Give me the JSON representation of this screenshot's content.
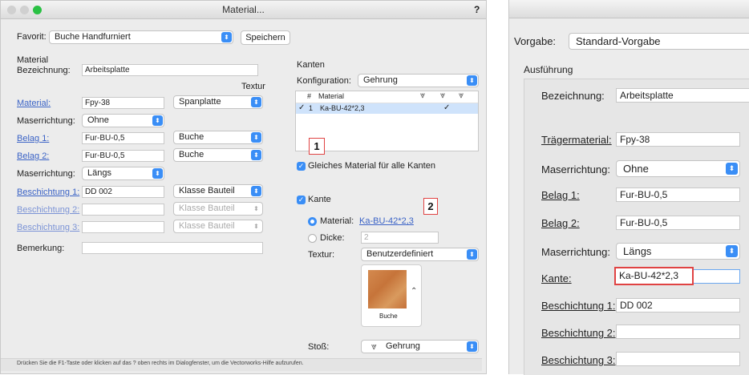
{
  "left_window": {
    "title": "Material...",
    "help": "?",
    "favorit_label": "Favorit:",
    "favorit_value": "Buche Handfurniert",
    "save_button": "Speichern",
    "material_section": "Material",
    "bezeichnung_label": "Bezeichnung:",
    "bezeichnung_value": "Arbeitsplatte",
    "textur_header": "Textur",
    "material_label": "Material:",
    "material_value": "Fpy-38",
    "material_textur": "Spanplatte",
    "maserrichtung1_label": "Maserrichtung:",
    "maserrichtung1_value": "Ohne",
    "belag1_label": "Belag 1:",
    "belag1_value": "Fur-BU-0,5",
    "belag1_textur": "Buche",
    "belag2_label": "Belag 2:",
    "belag2_value": "Fur-BU-0,5",
    "belag2_textur": "Buche",
    "maserrichtung2_label": "Maserrichtung:",
    "maserrichtung2_value": "Längs",
    "beschichtung1_label": "Beschichtung 1:",
    "beschichtung1_value": "DD 002",
    "beschichtung1_textur": "Klasse Bauteil",
    "beschichtung2_label": "Beschichtung 2:",
    "beschichtung2_value": "",
    "beschichtung2_textur": "Klasse Bauteil",
    "beschichtung3_label": "Beschichtung 3:",
    "beschichtung3_value": "",
    "beschichtung3_textur": "Klasse Bauteil",
    "bemerkung_label": "Bemerkung:",
    "bemerkung_value": "",
    "kanten_section": "Kanten",
    "konfiguration_label": "Konfiguration:",
    "konfiguration_value": "Gehrung",
    "table_headers": [
      "#",
      "Material"
    ],
    "table_rows": [
      {
        "check": "✓",
        "num": "1",
        "material": "Ka-BU-42*2,3",
        "mark": "✓"
      }
    ],
    "callout1": "1",
    "gleiches_material": "Gleiches Material für alle Kanten",
    "kante_label": "Kante",
    "callout2": "2",
    "material_radio_label": "Material:",
    "material_radio_link": "Ka-BU-42*2,3",
    "dicke_label": "Dicke:",
    "dicke_value": "2",
    "textur_label": "Textur:",
    "textur_value": "Benutzerdefiniert",
    "swatch_label": "Buche",
    "stoss_label": "Stoß:",
    "stoss_value": "Gehrung",
    "status_text": "Drücken Sie die F1-Taste oder klicken auf das ? oben rechts im Dialogfenster, um die Vectorworks-Hilfe aufzurufen."
  },
  "right_window": {
    "vorgabe_label": "Vorgabe:",
    "vorgabe_value": "Standard-Vorgabe",
    "ausfuehrung_section": "Ausführung",
    "bezeichnung_label": "Bezeichnung:",
    "bezeichnung_value": "Arbeitsplatte",
    "traegermaterial_label": "Trägermaterial:",
    "traegermaterial_value": "Fpy-38",
    "maserrichtung1_label": "Maserrichtung:",
    "maserrichtung1_value": "Ohne",
    "belag1_label": "Belag 1:",
    "belag1_value": "Fur-BU-0,5",
    "belag2_label": "Belag 2:",
    "belag2_value": "Fur-BU-0,5",
    "maserrichtung2_label": "Maserrichtung:",
    "maserrichtung2_value": "Längs",
    "kante_label": "Kante:",
    "kante_value": "Ka-BU-42*2,3",
    "beschichtung1_label": "Beschichtung 1:",
    "beschichtung1_value": "DD 002",
    "beschichtung2_label": "Beschichtung 2:",
    "beschichtung2_value": "",
    "beschichtung3_label": "Beschichtung 3:",
    "beschichtung3_value": ""
  },
  "colors": {
    "accent": "#3a8ef6",
    "link": "#3b63c6",
    "callout_border": "#e04343",
    "selected_row": "#cfe3fb"
  }
}
